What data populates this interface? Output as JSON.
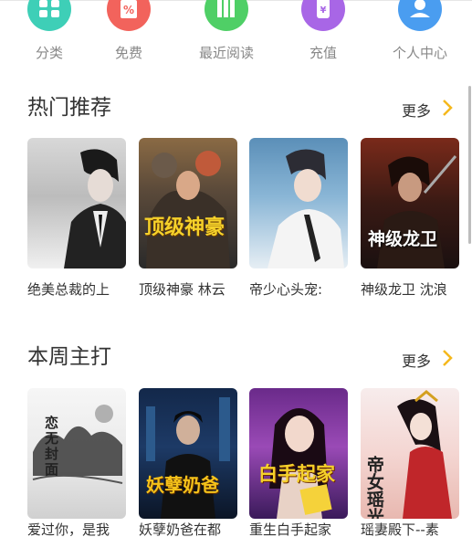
{
  "nav": {
    "items": [
      {
        "label": "分类",
        "icon": "grid-icon",
        "color": "#3ecfb7"
      },
      {
        "label": "免费",
        "icon": "percent-tag-icon",
        "color": "#f2635c"
      },
      {
        "label": "最近阅读",
        "icon": "books-icon",
        "color": "#4fcf66"
      },
      {
        "label": "充值",
        "icon": "money-bag-icon",
        "color": "#a866e6"
      },
      {
        "label": "个人中心",
        "icon": "user-icon",
        "color": "#4a9df0"
      }
    ]
  },
  "hot": {
    "title": "热门推荐",
    "more": "更多",
    "books": [
      {
        "name": "绝美总裁的上"
      },
      {
        "name": "顶级神豪 林云",
        "cover_text": "顶级神豪"
      },
      {
        "name": "帝少心头宠:"
      },
      {
        "name": "神级龙卫 沈浪",
        "cover_text": "神级龙卫"
      }
    ]
  },
  "weekly": {
    "title": "本周主打",
    "more": "更多",
    "books": [
      {
        "name": "爱过你，是我",
        "cover_text": "恋无封面"
      },
      {
        "name": "妖孽奶爸在都",
        "cover_text": "妖孽奶爸"
      },
      {
        "name": "重生白手起家",
        "cover_text": "白手起家"
      },
      {
        "name": "瑶妻殿下--素",
        "cover_text": "帝女瑶光"
      }
    ]
  },
  "colors": {
    "accent_chevron": "#f5b81c",
    "nav_label": "#888888"
  }
}
